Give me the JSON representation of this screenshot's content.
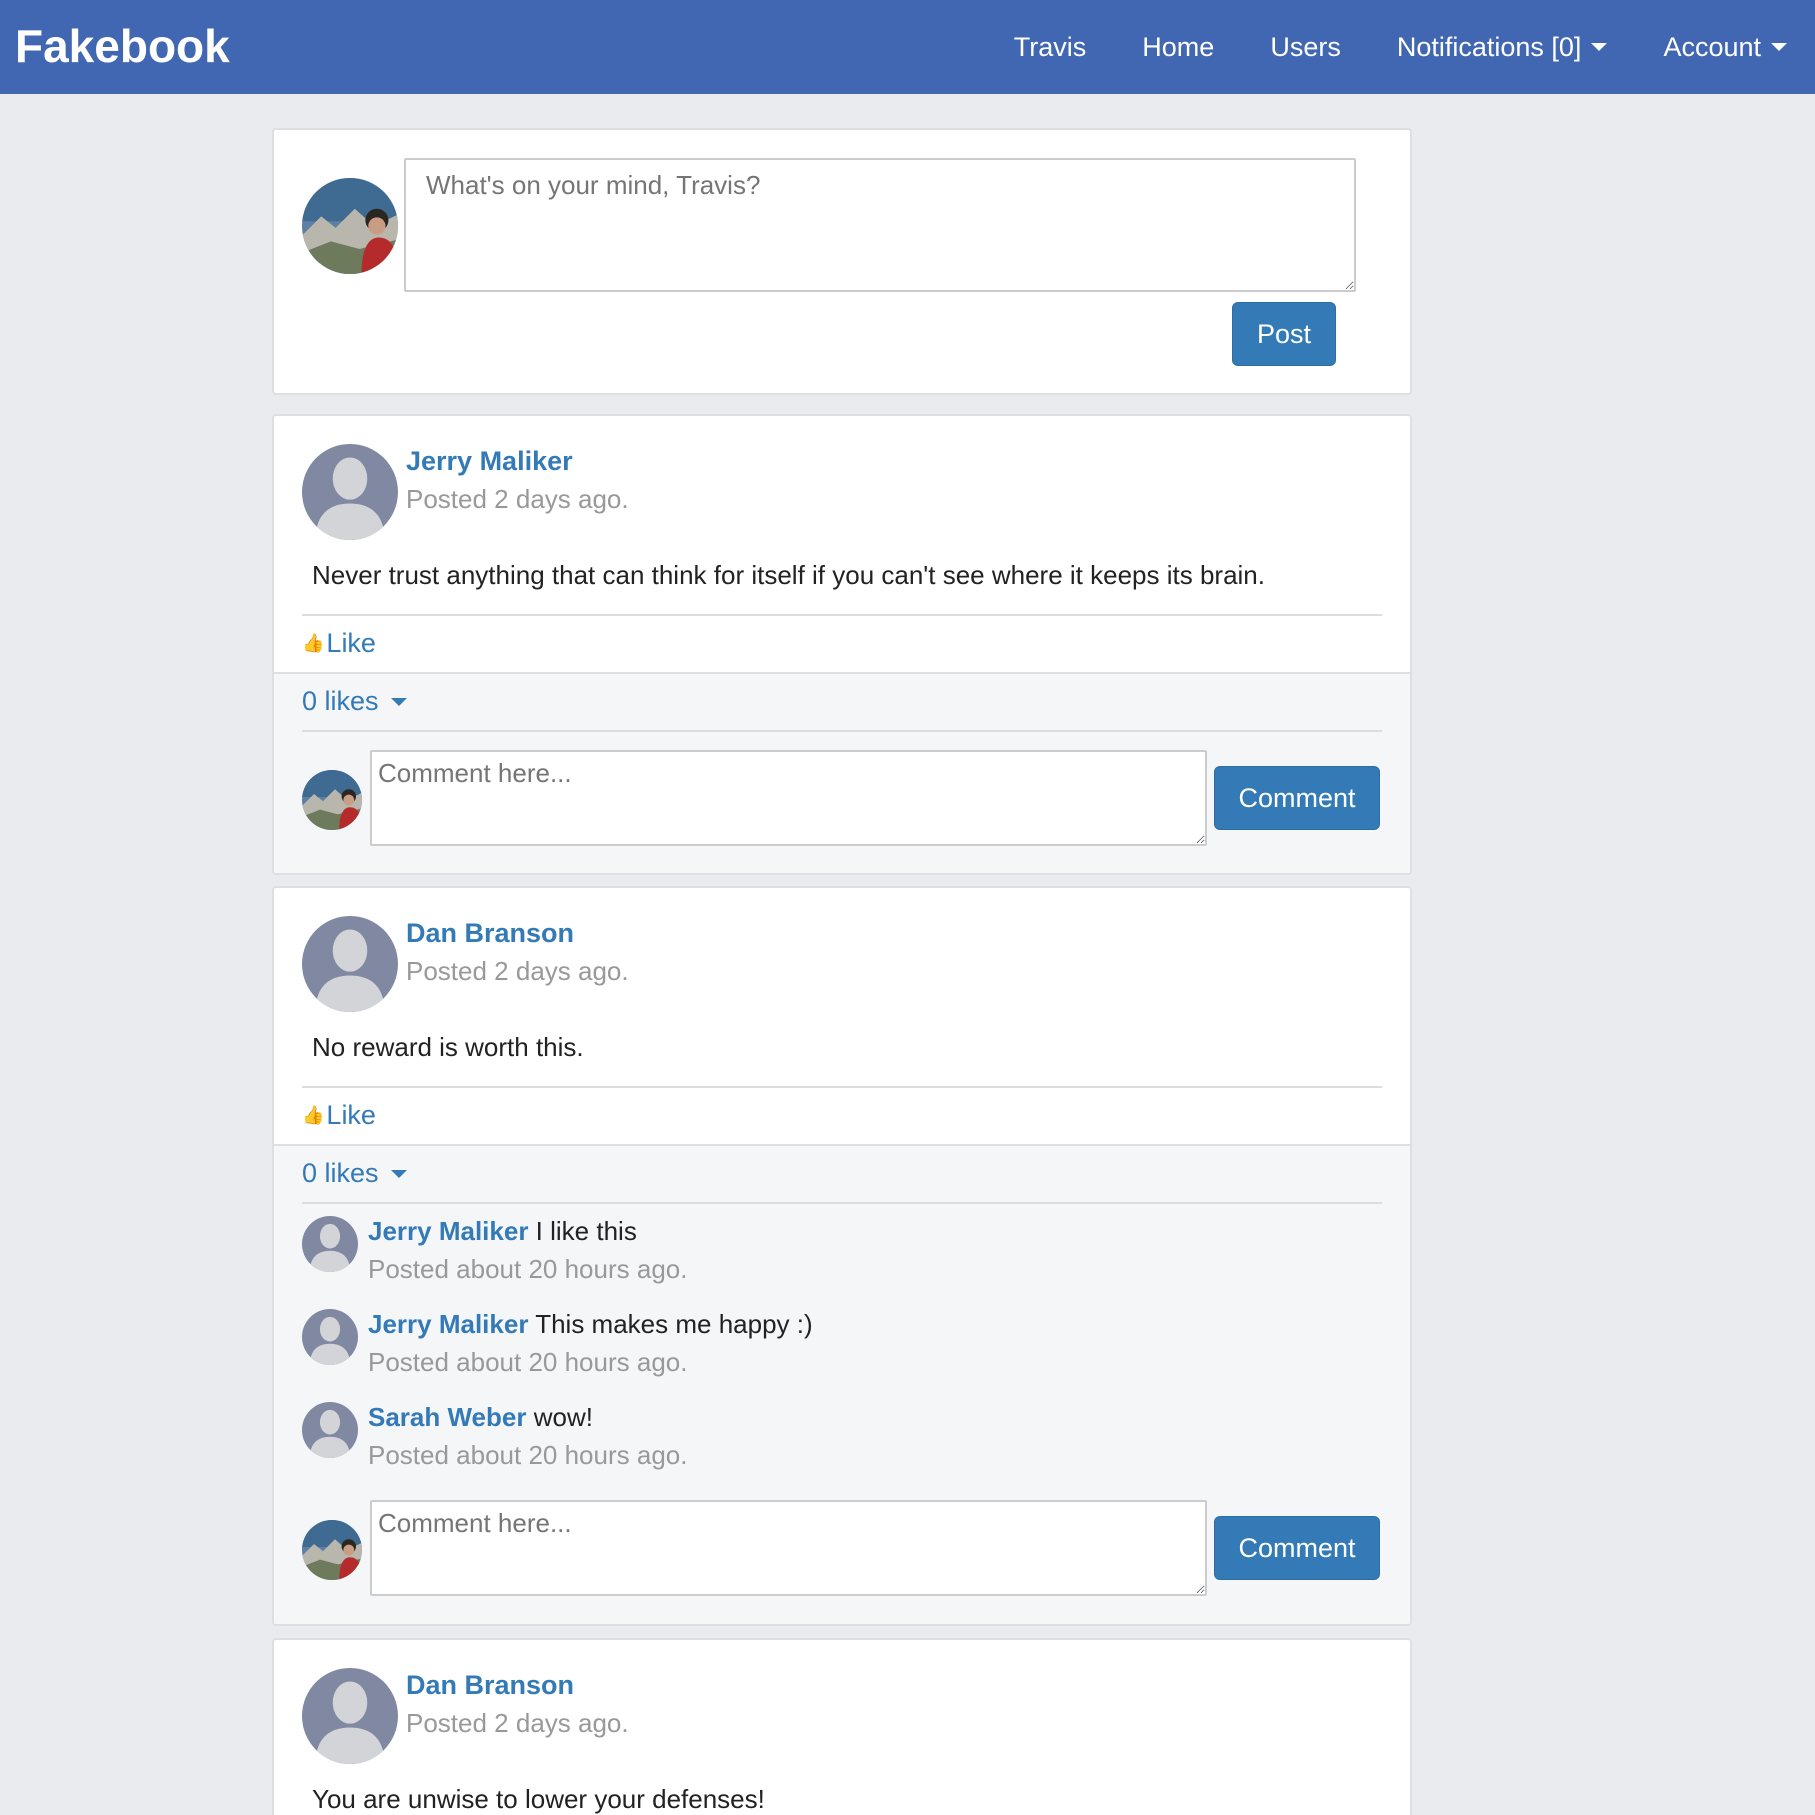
{
  "navbar": {
    "brand": "Fakebook",
    "items": [
      {
        "label": "Travis"
      },
      {
        "label": "Home"
      },
      {
        "label": "Users"
      },
      {
        "label": "Notifications [0]"
      },
      {
        "label": "Account"
      }
    ],
    "color": "#4267b2"
  },
  "composer": {
    "placeholder": "What's on your mind, Travis?",
    "post_label": "Post"
  },
  "posts": [
    {
      "author": "Jerry Maliker",
      "time": "Posted 2 days ago.",
      "body": "Never trust anything that can think for itself if you can't see where it keeps its brain.",
      "like_label": "Like",
      "likes_label": "0 likes",
      "comments": [],
      "comment_placeholder": "Comment here...",
      "comment_button": "Comment"
    },
    {
      "author": "Dan Branson",
      "time": "Posted 2 days ago.",
      "body": "No reward is worth this.",
      "like_label": "Like",
      "likes_label": "0 likes",
      "comments": [
        {
          "author": "Jerry Maliker",
          "text": " I like this",
          "time": "Posted about 20 hours ago."
        },
        {
          "author": "Jerry Maliker",
          "text": " This makes me happy :)",
          "time": "Posted about 20 hours ago."
        },
        {
          "author": "Sarah Weber",
          "text": " wow!",
          "time": "Posted about 20 hours ago."
        }
      ],
      "comment_placeholder": "Comment here...",
      "comment_button": "Comment"
    },
    {
      "author": "Dan Branson",
      "time": "Posted 2 days ago.",
      "body": "You are unwise to lower your defenses!"
    }
  ],
  "icons": {
    "thumb": "thumbs-up-icon",
    "caret": "caret-down-icon"
  }
}
